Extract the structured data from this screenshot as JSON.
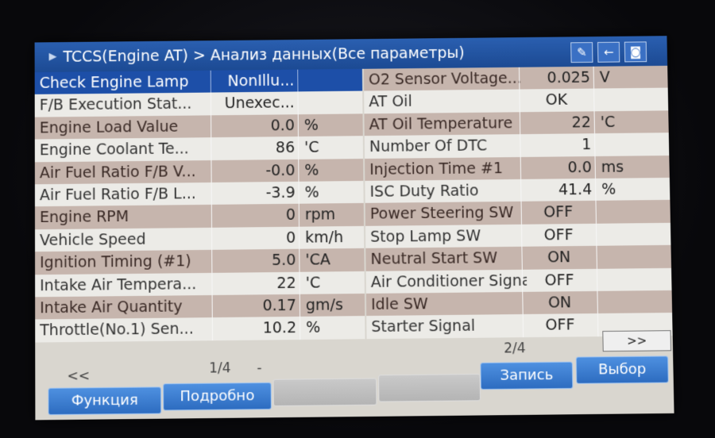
{
  "header": {
    "title": "TCCS(Engine AT) > Анализ данных(Все параметры)",
    "icons": [
      "pencil-icon",
      "back-arrow-icon",
      "camera-icon"
    ]
  },
  "left_table": [
    {
      "name": "Check Engine Lamp",
      "value": "NonIllu...",
      "unit": "",
      "selected": true
    },
    {
      "name": "F/B Execution Stat...",
      "value": "Unexec...",
      "unit": ""
    },
    {
      "name": "Engine Load Value",
      "value": "0.0",
      "unit": "%"
    },
    {
      "name": "Engine Coolant Te...",
      "value": "86",
      "unit": "'C"
    },
    {
      "name": "Air Fuel Ratio F/B V...",
      "value": "-0.0",
      "unit": "%"
    },
    {
      "name": "Air Fuel Ratio F/B L...",
      "value": "-3.9",
      "unit": "%"
    },
    {
      "name": "Engine RPM",
      "value": "0",
      "unit": "rpm"
    },
    {
      "name": "Vehicle Speed",
      "value": "0",
      "unit": "km/h"
    },
    {
      "name": "Ignition Timing (#1)",
      "value": "5.0",
      "unit": "'CA"
    },
    {
      "name": "Intake Air Tempera...",
      "value": "22",
      "unit": "'C"
    },
    {
      "name": "Intake Air Quantity",
      "value": "0.17",
      "unit": "gm/s"
    },
    {
      "name": "Throttle(No.1) Sen...",
      "value": "10.2",
      "unit": "%"
    }
  ],
  "right_table": [
    {
      "name": "O2 Sensor Voltage...",
      "value": "0.025",
      "unit": "V"
    },
    {
      "name": "AT Oil",
      "value": "OK",
      "unit": ""
    },
    {
      "name": "AT Oil Temperature",
      "value": "22",
      "unit": "'C"
    },
    {
      "name": "Number Of DTC",
      "value": "1",
      "unit": ""
    },
    {
      "name": "Injection Time #1",
      "value": "0.0",
      "unit": "ms"
    },
    {
      "name": "ISC Duty Ratio",
      "value": "41.4",
      "unit": "%"
    },
    {
      "name": "Power Steering SW",
      "value": "OFF",
      "unit": ""
    },
    {
      "name": "Stop Lamp SW",
      "value": "OFF",
      "unit": ""
    },
    {
      "name": "Neutral Start SW",
      "value": "ON",
      "unit": ""
    },
    {
      "name": "Air Conditioner Signal",
      "value": "OFF",
      "unit": ""
    },
    {
      "name": "Idle SW",
      "value": "ON",
      "unit": ""
    },
    {
      "name": "Starter Signal",
      "value": "OFF",
      "unit": ""
    }
  ],
  "pager": {
    "left_page": "1/4",
    "right_page": "2/4",
    "prev_label": "<<",
    "next_label": ">>",
    "dash": "-"
  },
  "buttons": {
    "function": "Функция",
    "details": "Подробно",
    "record": "Запись",
    "select": "Выбор"
  }
}
